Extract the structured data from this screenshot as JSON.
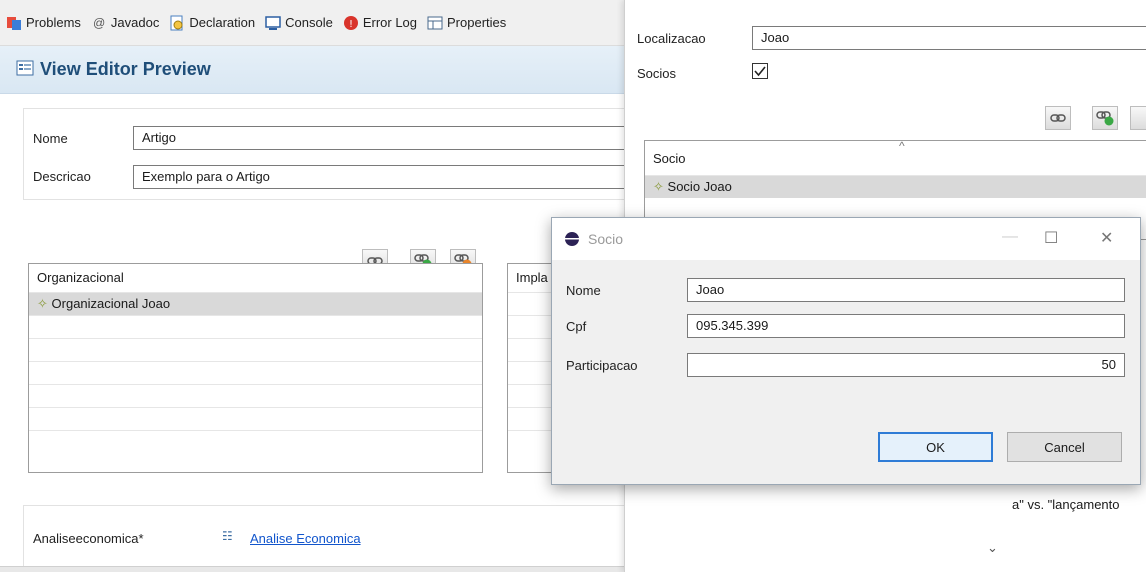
{
  "tabs": [
    {
      "label": "Problems",
      "icon": "problems-icon"
    },
    {
      "label": "Javadoc",
      "icon": "javadoc-icon"
    },
    {
      "label": "Declaration",
      "icon": "declaration-icon"
    },
    {
      "label": "Console",
      "icon": "console-icon"
    },
    {
      "label": "Error Log",
      "icon": "error-log-icon"
    },
    {
      "label": "Properties",
      "icon": "properties-icon"
    }
  ],
  "editor": {
    "title": "View Editor Preview",
    "nome_label": "Nome",
    "nome_value": "Artigo",
    "descricao_label": "Descricao",
    "descricao_value": "Exemplo para o Artigo",
    "org_table": {
      "header": "Organizacional",
      "rows": [
        "Organizacional Joao"
      ]
    },
    "impl_header": "Impla",
    "analise_label": "Analiseeconomica*",
    "analise_link": "Analise Economica"
  },
  "right_window": {
    "localizacao_label": "Localizacao",
    "localizacao_value": "Joao",
    "socios_label": "Socios",
    "socios_checked": true,
    "socio_table": {
      "header": "Socio",
      "rows": [
        "Socio Joao"
      ]
    },
    "background_text": "a\" vs. \"lançamento"
  },
  "dialog": {
    "title": "Socio",
    "nome_label": "Nome",
    "nome_value": "Joao",
    "cpf_label": "Cpf",
    "cpf_value": "095.345.399",
    "participacao_label": "Participacao",
    "participacao_value": "50",
    "ok_label": "OK",
    "cancel_label": "Cancel"
  }
}
